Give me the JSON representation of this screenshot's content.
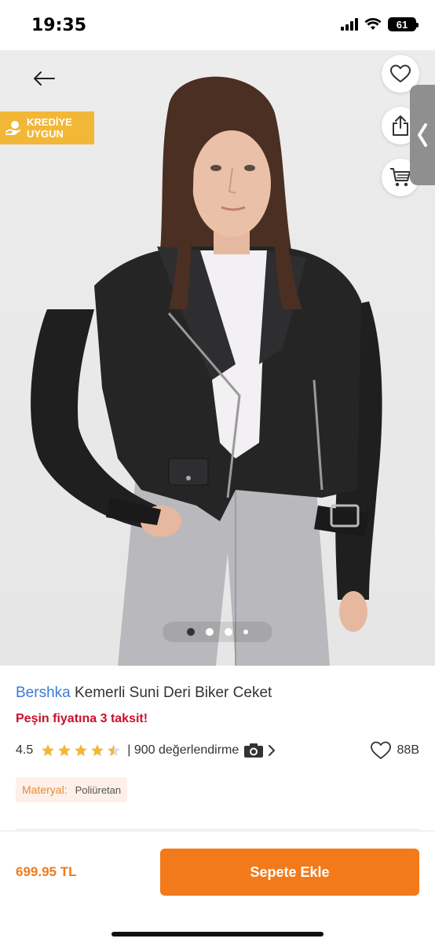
{
  "status_bar": {
    "time": "19:35",
    "battery": "61"
  },
  "hero": {
    "credit_badge": "KREDİYE\nUYGUN",
    "carousel": {
      "total": 4,
      "active": 1
    }
  },
  "product": {
    "brand": "Bershka",
    "name": "Kemerli Suni Deri Biker Ceket",
    "promo": "Peşin fiyatına 3 taksit!",
    "rating": "4.5",
    "rating_value": 4.5,
    "reviews": "| 900 değerlendirme",
    "favorites": "88B",
    "material_label": "Materyal:",
    "material_value": "Poliüretan"
  },
  "bottom": {
    "price": "699.95 TL",
    "add_to_cart": "Sepete Ekle"
  },
  "colors": {
    "accent": "#f27a1a",
    "brand_link": "#3a7bd5",
    "promo": "#c8102e",
    "badge": "#f2b736"
  }
}
